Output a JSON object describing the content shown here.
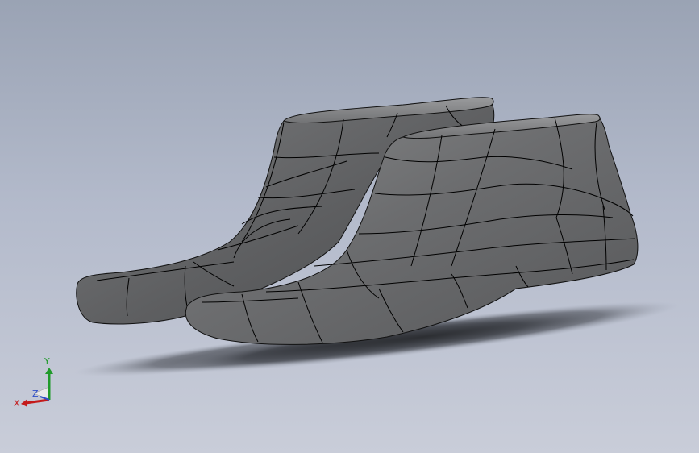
{
  "viewport": {
    "background_top": "#9aa3b4",
    "background_bottom": "#c9cdd9"
  },
  "model": {
    "part_color": "#6b6c6e",
    "edge_color": "#000000",
    "shadow_color": "#2a2c30"
  },
  "triad": {
    "x_label": "X",
    "y_label": "Y",
    "z_label": "Z",
    "x_color": "#c41a1a",
    "y_color": "#1f9a2a",
    "z_color": "#3050c8"
  }
}
